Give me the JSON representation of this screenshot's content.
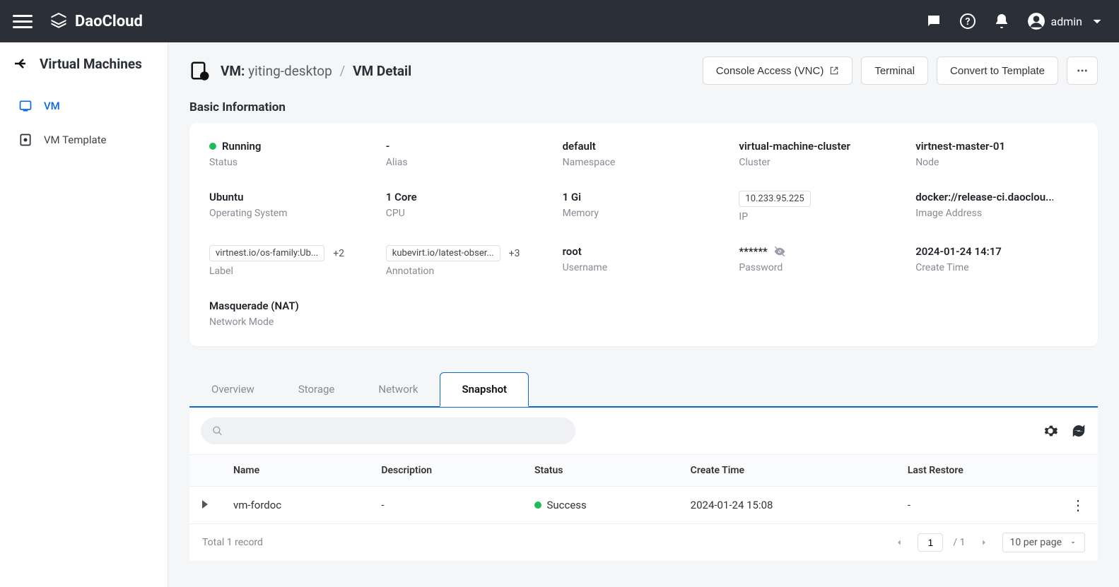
{
  "header": {
    "brand": "DaoCloud",
    "user": "admin"
  },
  "sidebar": {
    "title": "Virtual Machines",
    "items": [
      {
        "label": "VM"
      },
      {
        "label": "VM Template"
      }
    ]
  },
  "breadcrumb": {
    "prefix": "VM:",
    "vm_name": "yiting-desktop",
    "page": "VM Detail"
  },
  "actions": {
    "console": "Console Access (VNC)",
    "terminal": "Terminal",
    "convert": "Convert to Template"
  },
  "section_title": "Basic Information",
  "info": {
    "status": {
      "value": "Running",
      "label": "Status"
    },
    "alias": {
      "value": "-",
      "label": "Alias"
    },
    "namespace": {
      "value": "default",
      "label": "Namespace"
    },
    "cluster": {
      "value": "virtual-machine-cluster",
      "label": "Cluster"
    },
    "node": {
      "value": "virtnest-master-01",
      "label": "Node"
    },
    "os": {
      "value": "Ubuntu",
      "label": "Operating System"
    },
    "cpu": {
      "value": "1 Core",
      "label": "CPU"
    },
    "memory": {
      "value": "1 Gi",
      "label": "Memory"
    },
    "ip": {
      "value": "10.233.95.225",
      "label": "IP"
    },
    "image": {
      "value": "docker://release-ci.daoclou...",
      "label": "Image Address"
    },
    "label_chip": {
      "value": "virtnest.io/os-family:Ub...",
      "extra": "+2",
      "label": "Label"
    },
    "annotation_chip": {
      "value": "kubevirt.io/latest-obser...",
      "extra": "+3",
      "label": "Annotation"
    },
    "username": {
      "value": "root",
      "label": "Username"
    },
    "password": {
      "value": "******",
      "label": "Password"
    },
    "create_time": {
      "value": "2024-01-24 14:17",
      "label": "Create Time"
    },
    "network": {
      "value": "Masquerade (NAT)",
      "label": "Network Mode"
    }
  },
  "tabs": [
    {
      "label": "Overview"
    },
    {
      "label": "Storage"
    },
    {
      "label": "Network"
    },
    {
      "label": "Snapshot"
    }
  ],
  "table": {
    "columns": [
      "Name",
      "Description",
      "Status",
      "Create Time",
      "Last Restore"
    ],
    "rows": [
      {
        "name": "vm-fordoc",
        "description": "-",
        "status": "Success",
        "create_time": "2024-01-24 15:08",
        "last_restore": "-"
      }
    ]
  },
  "pagination": {
    "total_text": "Total 1 record",
    "current": "1",
    "total_pages": "1",
    "per_page": "10 per page"
  }
}
